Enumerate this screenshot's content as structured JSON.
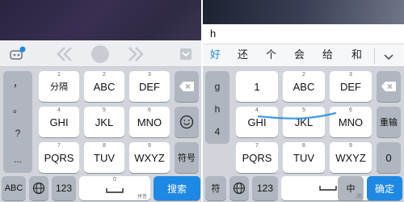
{
  "left": {
    "toolbar": {
      "icons": [
        "robot-icon",
        "chevron-left-icon",
        "center-dot-icon",
        "chevron-right-icon",
        "collapse-icon"
      ]
    },
    "side_column": [
      "，",
      "。",
      "?",
      "..."
    ],
    "rows": [
      {
        "keys": [
          {
            "num": "1",
            "label": "分隔"
          },
          {
            "num": "2",
            "label": "ABC"
          },
          {
            "num": "3",
            "label": "DEF"
          }
        ]
      },
      {
        "keys": [
          {
            "num": "4",
            "label": "GHI"
          },
          {
            "num": "5",
            "label": "JKL"
          },
          {
            "num": "6",
            "label": "MNO"
          }
        ]
      },
      {
        "keys": [
          {
            "num": "7",
            "label": "PQRS"
          },
          {
            "num": "8",
            "label": "TUV"
          },
          {
            "num": "9",
            "label": "WXYZ"
          }
        ]
      }
    ],
    "right_keys": {
      "backspace": "backspace-icon",
      "emoji": "emoji-icon",
      "symbol": "符号"
    },
    "bottom": {
      "abc": "ABC",
      "globe": "globe-icon",
      "num": "123",
      "space_num": "0",
      "space_sub": "拼音",
      "search": "搜索"
    }
  },
  "right": {
    "input_text": "h",
    "candidates": [
      "好",
      "还",
      "个",
      "会",
      "给",
      "和"
    ],
    "side_column": [
      "g",
      "h",
      "4"
    ],
    "rows": [
      {
        "keys": [
          {
            "num": "",
            "label": "1"
          },
          {
            "num": "2",
            "label": "ABC"
          },
          {
            "num": "3",
            "label": "DEF"
          }
        ]
      },
      {
        "keys": [
          {
            "num": "4",
            "label": "GHI"
          },
          {
            "num": "5",
            "label": "JKL"
          },
          {
            "num": "6",
            "label": "MNO"
          }
        ]
      },
      {
        "keys": [
          {
            "num": "7",
            "label": "PQRS"
          },
          {
            "num": "8",
            "label": "TUV"
          },
          {
            "num": "9",
            "label": "WXYZ"
          }
        ]
      }
    ],
    "right_keys": {
      "backspace": "backspace-icon",
      "retype": "重输",
      "zero": "0"
    },
    "bottom": {
      "symbol": "符",
      "globe": "globe-icon",
      "num": "123",
      "cn": "中",
      "cn_sub": "/英",
      "confirm": "确定"
    }
  },
  "colors": {
    "accent": "#1e88e5",
    "func_key": "#b0b6bf",
    "key": "#ffffff",
    "keyboard_bg": "#d1d5db"
  }
}
